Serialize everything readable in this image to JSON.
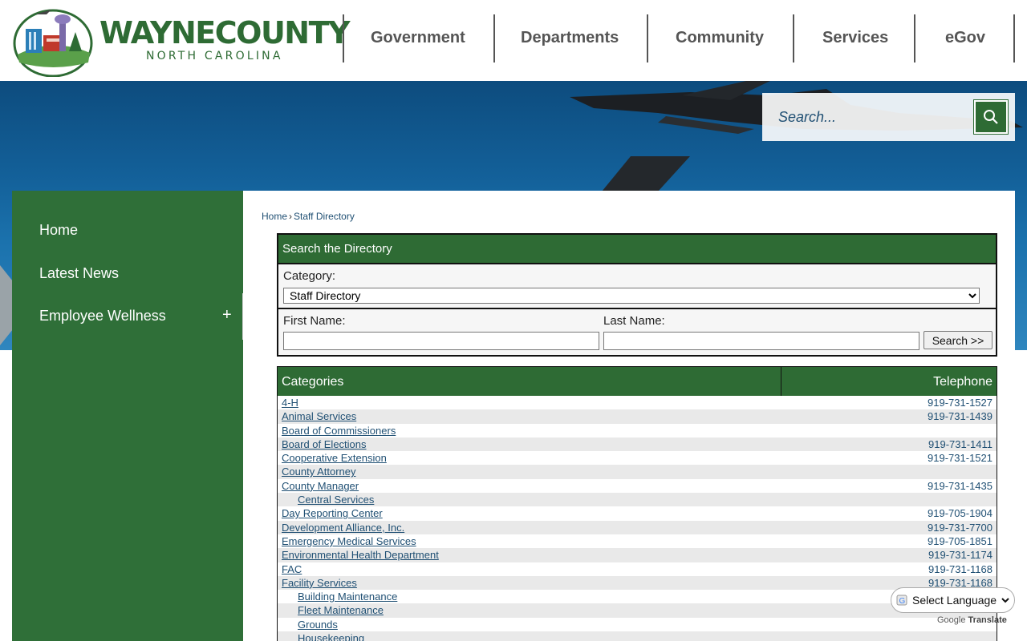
{
  "header": {
    "logo_name": "WAYNECOUNTY",
    "logo_sub": "NORTH CAROLINA",
    "nav": [
      "Government",
      "Departments",
      "Community",
      "Services",
      "eGov"
    ]
  },
  "search": {
    "placeholder": "Search..."
  },
  "sidebar": {
    "items": [
      {
        "label": "Home"
      },
      {
        "label": "Latest News"
      },
      {
        "label": "Employee Wellness",
        "expand": "+"
      }
    ]
  },
  "breadcrumb": {
    "home": "Home",
    "sep": "›",
    "current": "Staff Directory"
  },
  "directory": {
    "title": "Search the Directory",
    "category_label": "Category:",
    "category_value": "Staff Directory",
    "first_name_label": "First Name:",
    "last_name_label": "Last Name:",
    "search_button": "Search >>"
  },
  "table": {
    "headers": {
      "categories": "Categories",
      "telephone": "Telephone"
    },
    "rows": [
      {
        "name": "4-H",
        "phone": "919-731-1527",
        "sub": false
      },
      {
        "name": "Animal Services",
        "phone": "919-731-1439",
        "sub": false
      },
      {
        "name": "Board of Commissioners",
        "phone": "",
        "sub": false
      },
      {
        "name": "Board of Elections",
        "phone": "919-731-1411",
        "sub": false
      },
      {
        "name": "Cooperative Extension",
        "phone": "919-731-1521",
        "sub": false
      },
      {
        "name": "County Attorney",
        "phone": "",
        "sub": false
      },
      {
        "name": "County Manager",
        "phone": "919-731-1435",
        "sub": false
      },
      {
        "name": "Central Services",
        "phone": "",
        "sub": true
      },
      {
        "name": "Day Reporting Center",
        "phone": "919-705-1904",
        "sub": false
      },
      {
        "name": "Development Alliance, Inc.",
        "phone": "919-731-7700",
        "sub": false
      },
      {
        "name": "Emergency Medical Services",
        "phone": "919-705-1851",
        "sub": false
      },
      {
        "name": "Environmental Health Department",
        "phone": "919-731-1174",
        "sub": false
      },
      {
        "name": "FAC",
        "phone": "919-731-1168",
        "sub": false
      },
      {
        "name": "Facility Services",
        "phone": "919-731-1168",
        "sub": false
      },
      {
        "name": "Building Maintenance",
        "phone": "",
        "sub": true
      },
      {
        "name": "Fleet Maintenance",
        "phone": "",
        "sub": true
      },
      {
        "name": "Grounds",
        "phone": "",
        "sub": true
      },
      {
        "name": "Housekeeping",
        "phone": "",
        "sub": true
      }
    ]
  },
  "translate": {
    "select_label": "Select Language",
    "powered_by": "Google",
    "translate_word": "Translate"
  },
  "colors": {
    "brand_green": "#2e6b34",
    "link_blue": "#1f4f73",
    "nav_gray": "#555555"
  },
  "icons": [
    "logo-emblem-icon",
    "search-icon",
    "google-g-icon"
  ]
}
